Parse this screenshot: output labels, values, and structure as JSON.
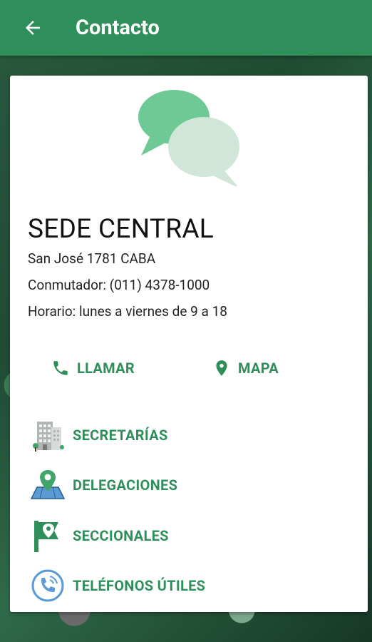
{
  "header": {
    "title": "Contacto",
    "back_icon": "arrow-left-icon"
  },
  "office": {
    "name": "SEDE CENTRAL",
    "address": "San José 1781 CABA",
    "phone": "Conmutador: (011) 4378-1000",
    "hours": "Horario: lunes a viernes de 9 a 18"
  },
  "actions": {
    "call_label": "LLAMAR",
    "map_label": "MAPA"
  },
  "menu": [
    {
      "label": "SECRETARÍAS",
      "icon": "building-icon"
    },
    {
      "label": "DELEGACIONES",
      "icon": "map-pin-icon"
    },
    {
      "label": "SECCIONALES",
      "icon": "location-flag-icon"
    },
    {
      "label": "TELÉFONOS ÚTILES",
      "icon": "phone-circle-icon"
    }
  ],
  "colors": {
    "accent": "#2f8f5b",
    "bubble_dark": "#6fc995",
    "bubble_light": "#cfe6d9"
  }
}
